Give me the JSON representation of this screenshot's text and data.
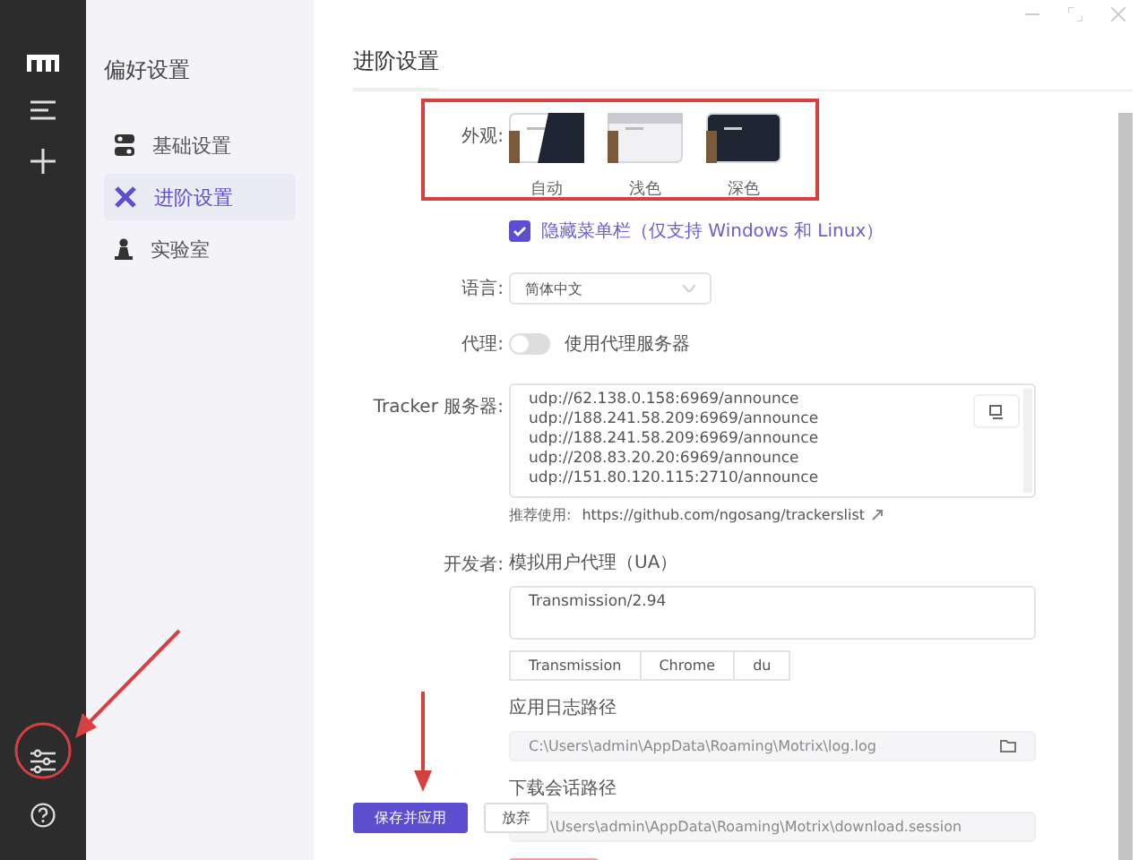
{
  "sidebar": {
    "title": "偏好设置",
    "items": [
      {
        "label": "基础设置",
        "selected": false
      },
      {
        "label": "进阶设置",
        "selected": true
      },
      {
        "label": "实验室",
        "selected": false
      }
    ]
  },
  "page_title": "进阶设置",
  "appearance": {
    "label": "外观:",
    "themes": [
      {
        "label": "自动",
        "kind": "auto"
      },
      {
        "label": "浅色",
        "kind": "light"
      },
      {
        "label": "深色",
        "kind": "dark"
      }
    ]
  },
  "hide_menu": {
    "label": "隐藏菜单栏（仅支持 Windows 和 Linux）",
    "checked": true
  },
  "language": {
    "label": "语言:",
    "value": "简体中文"
  },
  "proxy": {
    "label": "代理:",
    "on": false,
    "text": "使用代理服务器"
  },
  "tracker": {
    "label": "Tracker 服务器:",
    "lines": [
      "udp://62.138.0.158:6969/announce",
      "udp://188.241.58.209:6969/announce",
      "udp://188.241.58.209:6969/announce",
      "udp://208.83.20.20:6969/announce",
      "udp://151.80.120.115:2710/announce"
    ],
    "hint": "推荐使用:",
    "link": "https://github.com/ngosang/trackerslist"
  },
  "developer": {
    "label": "开发者:",
    "ua_label": "模拟用户代理（UA）",
    "ua_value": "Transmission/2.94",
    "presets": [
      "Transmission",
      "Chrome",
      "du"
    ],
    "log_label": "应用日志路径",
    "log_path": "C:\\Users\\admin\\AppData\\Roaming\\Motrix\\log.log",
    "session_label": "下载会话路径",
    "session_path": "\\Users\\admin\\AppData\\Roaming\\Motrix\\download.session"
  },
  "footer": {
    "buttons": [
      {
        "label": "保存并应用",
        "kind": "primary"
      },
      {
        "label": "放弃",
        "kind": "plain"
      }
    ]
  }
}
